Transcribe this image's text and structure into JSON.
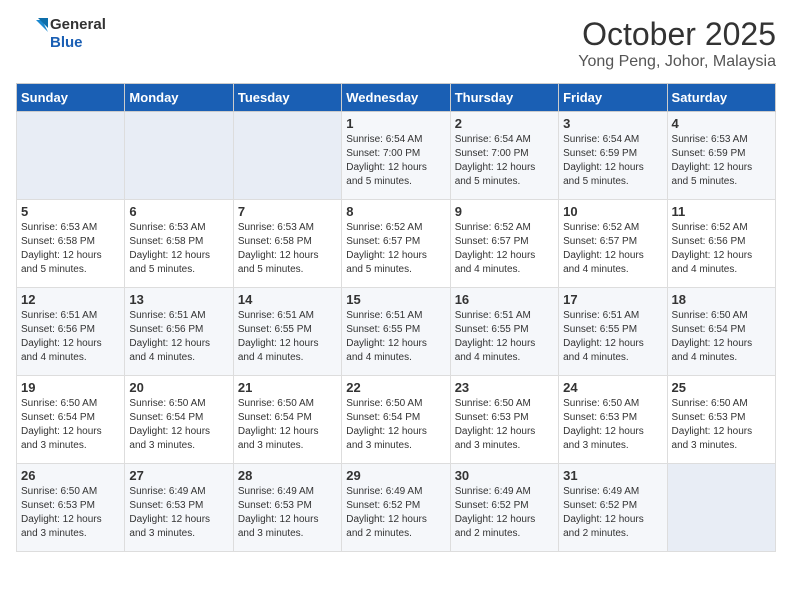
{
  "header": {
    "logo_line1": "General",
    "logo_line2": "Blue",
    "title": "October 2025",
    "subtitle": "Yong Peng, Johor, Malaysia"
  },
  "weekdays": [
    "Sunday",
    "Monday",
    "Tuesday",
    "Wednesday",
    "Thursday",
    "Friday",
    "Saturday"
  ],
  "weeks": [
    [
      {
        "day": "",
        "detail": ""
      },
      {
        "day": "",
        "detail": ""
      },
      {
        "day": "",
        "detail": ""
      },
      {
        "day": "1",
        "detail": "Sunrise: 6:54 AM\nSunset: 7:00 PM\nDaylight: 12 hours\nand 5 minutes."
      },
      {
        "day": "2",
        "detail": "Sunrise: 6:54 AM\nSunset: 7:00 PM\nDaylight: 12 hours\nand 5 minutes."
      },
      {
        "day": "3",
        "detail": "Sunrise: 6:54 AM\nSunset: 6:59 PM\nDaylight: 12 hours\nand 5 minutes."
      },
      {
        "day": "4",
        "detail": "Sunrise: 6:53 AM\nSunset: 6:59 PM\nDaylight: 12 hours\nand 5 minutes."
      }
    ],
    [
      {
        "day": "5",
        "detail": "Sunrise: 6:53 AM\nSunset: 6:58 PM\nDaylight: 12 hours\nand 5 minutes."
      },
      {
        "day": "6",
        "detail": "Sunrise: 6:53 AM\nSunset: 6:58 PM\nDaylight: 12 hours\nand 5 minutes."
      },
      {
        "day": "7",
        "detail": "Sunrise: 6:53 AM\nSunset: 6:58 PM\nDaylight: 12 hours\nand 5 minutes."
      },
      {
        "day": "8",
        "detail": "Sunrise: 6:52 AM\nSunset: 6:57 PM\nDaylight: 12 hours\nand 5 minutes."
      },
      {
        "day": "9",
        "detail": "Sunrise: 6:52 AM\nSunset: 6:57 PM\nDaylight: 12 hours\nand 4 minutes."
      },
      {
        "day": "10",
        "detail": "Sunrise: 6:52 AM\nSunset: 6:57 PM\nDaylight: 12 hours\nand 4 minutes."
      },
      {
        "day": "11",
        "detail": "Sunrise: 6:52 AM\nSunset: 6:56 PM\nDaylight: 12 hours\nand 4 minutes."
      }
    ],
    [
      {
        "day": "12",
        "detail": "Sunrise: 6:51 AM\nSunset: 6:56 PM\nDaylight: 12 hours\nand 4 minutes."
      },
      {
        "day": "13",
        "detail": "Sunrise: 6:51 AM\nSunset: 6:56 PM\nDaylight: 12 hours\nand 4 minutes."
      },
      {
        "day": "14",
        "detail": "Sunrise: 6:51 AM\nSunset: 6:55 PM\nDaylight: 12 hours\nand 4 minutes."
      },
      {
        "day": "15",
        "detail": "Sunrise: 6:51 AM\nSunset: 6:55 PM\nDaylight: 12 hours\nand 4 minutes."
      },
      {
        "day": "16",
        "detail": "Sunrise: 6:51 AM\nSunset: 6:55 PM\nDaylight: 12 hours\nand 4 minutes."
      },
      {
        "day": "17",
        "detail": "Sunrise: 6:51 AM\nSunset: 6:55 PM\nDaylight: 12 hours\nand 4 minutes."
      },
      {
        "day": "18",
        "detail": "Sunrise: 6:50 AM\nSunset: 6:54 PM\nDaylight: 12 hours\nand 4 minutes."
      }
    ],
    [
      {
        "day": "19",
        "detail": "Sunrise: 6:50 AM\nSunset: 6:54 PM\nDaylight: 12 hours\nand 3 minutes."
      },
      {
        "day": "20",
        "detail": "Sunrise: 6:50 AM\nSunset: 6:54 PM\nDaylight: 12 hours\nand 3 minutes."
      },
      {
        "day": "21",
        "detail": "Sunrise: 6:50 AM\nSunset: 6:54 PM\nDaylight: 12 hours\nand 3 minutes."
      },
      {
        "day": "22",
        "detail": "Sunrise: 6:50 AM\nSunset: 6:54 PM\nDaylight: 12 hours\nand 3 minutes."
      },
      {
        "day": "23",
        "detail": "Sunrise: 6:50 AM\nSunset: 6:53 PM\nDaylight: 12 hours\nand 3 minutes."
      },
      {
        "day": "24",
        "detail": "Sunrise: 6:50 AM\nSunset: 6:53 PM\nDaylight: 12 hours\nand 3 minutes."
      },
      {
        "day": "25",
        "detail": "Sunrise: 6:50 AM\nSunset: 6:53 PM\nDaylight: 12 hours\nand 3 minutes."
      }
    ],
    [
      {
        "day": "26",
        "detail": "Sunrise: 6:50 AM\nSunset: 6:53 PM\nDaylight: 12 hours\nand 3 minutes."
      },
      {
        "day": "27",
        "detail": "Sunrise: 6:49 AM\nSunset: 6:53 PM\nDaylight: 12 hours\nand 3 minutes."
      },
      {
        "day": "28",
        "detail": "Sunrise: 6:49 AM\nSunset: 6:53 PM\nDaylight: 12 hours\nand 3 minutes."
      },
      {
        "day": "29",
        "detail": "Sunrise: 6:49 AM\nSunset: 6:52 PM\nDaylight: 12 hours\nand 2 minutes."
      },
      {
        "day": "30",
        "detail": "Sunrise: 6:49 AM\nSunset: 6:52 PM\nDaylight: 12 hours\nand 2 minutes."
      },
      {
        "day": "31",
        "detail": "Sunrise: 6:49 AM\nSunset: 6:52 PM\nDaylight: 12 hours\nand 2 minutes."
      },
      {
        "day": "",
        "detail": ""
      }
    ]
  ]
}
